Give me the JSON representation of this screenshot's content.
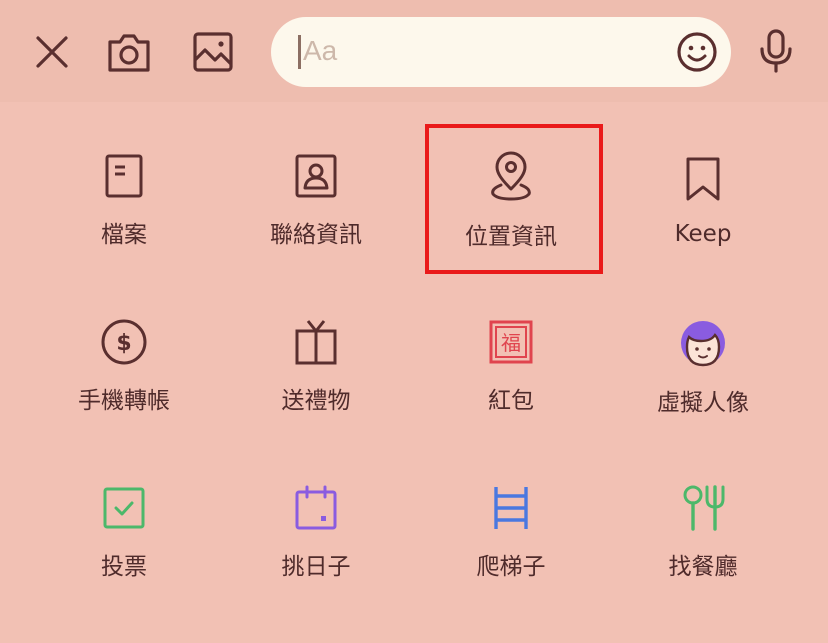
{
  "toolbar": {
    "close_icon": "close-icon",
    "camera_icon": "camera-icon",
    "image_icon": "image-icon",
    "input_placeholder": "Aa",
    "emoji_icon": "smiley-icon",
    "mic_icon": "microphone-icon"
  },
  "menu": {
    "items": [
      {
        "label": "檔案",
        "icon": "file-icon"
      },
      {
        "label": "聯絡資訊",
        "icon": "contact-card-icon"
      },
      {
        "label": "位置資訊",
        "icon": "location-pin-icon",
        "highlighted": true
      },
      {
        "label": "Keep",
        "icon": "bookmark-icon"
      },
      {
        "label": "手機轉帳",
        "icon": "dollar-icon"
      },
      {
        "label": "送禮物",
        "icon": "gift-icon"
      },
      {
        "label": "紅包",
        "icon": "red-envelope-icon",
        "glyph": "福"
      },
      {
        "label": "虛擬人像",
        "icon": "avatar-icon"
      },
      {
        "label": "投票",
        "icon": "vote-check-icon"
      },
      {
        "label": "挑日子",
        "icon": "calendar-icon"
      },
      {
        "label": "爬梯子",
        "icon": "ladder-icon"
      },
      {
        "label": "找餐廳",
        "icon": "restaurant-icon"
      }
    ]
  },
  "colors": {
    "background": "#f2c1b4",
    "topbar": "#eebdaf",
    "icon_dark": "#5a2f2f",
    "red": "#e0444e",
    "purple": "#8a5ce0",
    "green": "#4cb86a",
    "blue": "#4a78e0",
    "highlight": "#ea1a1a"
  }
}
